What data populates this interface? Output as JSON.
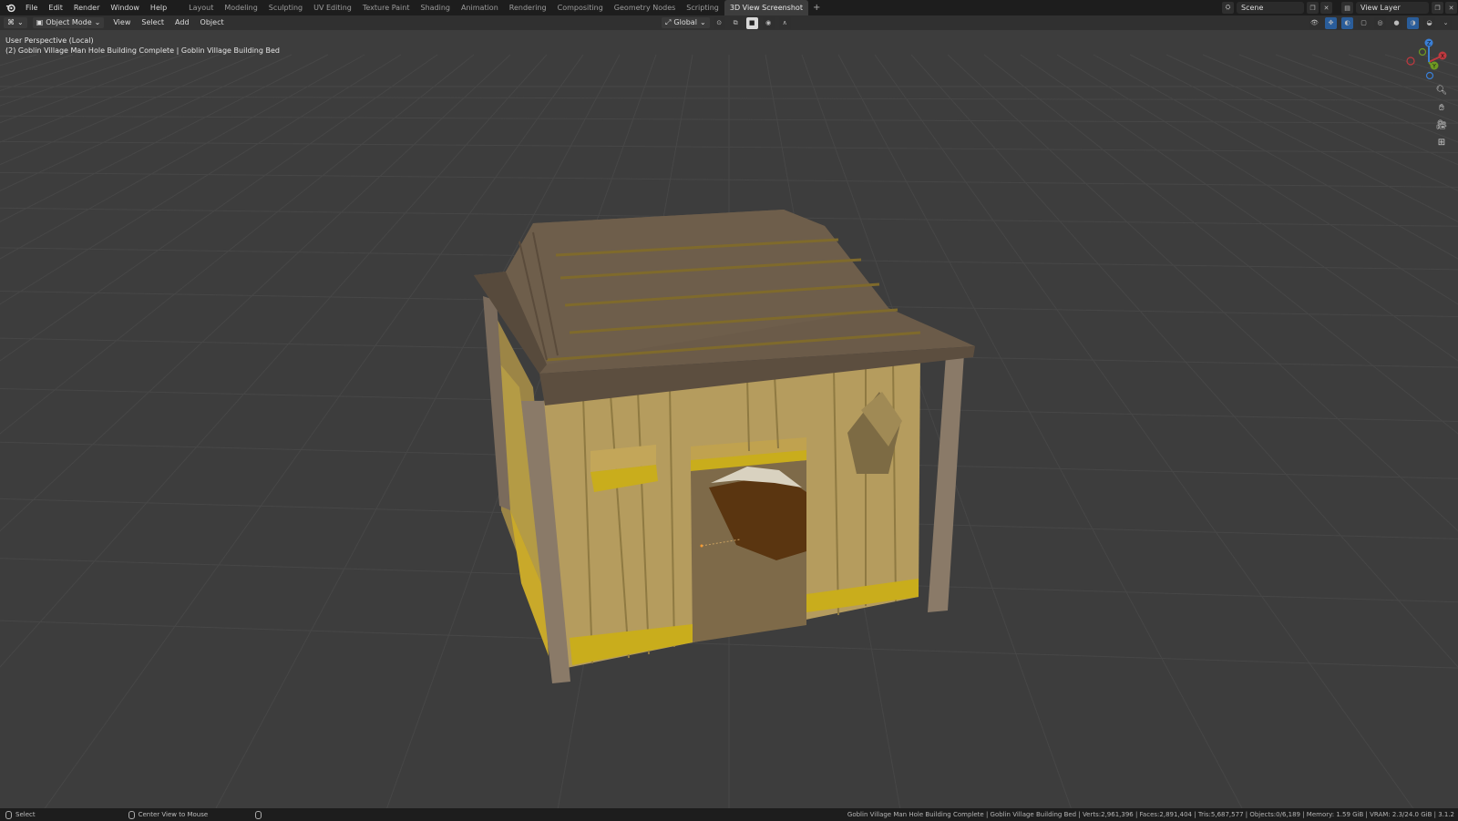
{
  "menu": [
    "File",
    "Edit",
    "Render",
    "Window",
    "Help"
  ],
  "workspaces": [
    "Layout",
    "Modeling",
    "Sculpting",
    "UV Editing",
    "Texture Paint",
    "Shading",
    "Animation",
    "Rendering",
    "Compositing",
    "Geometry Nodes",
    "Scripting",
    "3D View Screenshot"
  ],
  "active_workspace": "3D View Screenshot",
  "add_workspace": "+",
  "scene_name": "Scene",
  "view_layer": "View Layer",
  "header": {
    "mode": "Object Mode",
    "menus": [
      "View",
      "Select",
      "Add",
      "Object"
    ],
    "transform_orientation": "Global"
  },
  "viewport": {
    "perspective_label": "User Perspective (Local)",
    "object_label": "(2) Goblin Village Man Hole Building Complete | Goblin Village Building Bed"
  },
  "gizmo": {
    "x": "X",
    "y": "Y",
    "z": "Z"
  },
  "status": {
    "left_action": "Select",
    "middle_action": "Center View to Mouse",
    "stats": "Goblin Village Man Hole Building Complete | Goblin Village Building Bed | Verts:2,961,396 | Faces:2,891,404 | Tris:5,687,577 | Objects:0/6,189 | Memory: 1.59 GiB | VRAM: 2.3/24.0 GiB | 3.1.2"
  },
  "colors": {
    "topbar": "#1d1d1d",
    "viewport_bg": "#3d3d3d",
    "grid": "#474747",
    "axis_x": "#c0393f",
    "axis_y": "#6f9a22",
    "axis_z": "#3a7fd6",
    "roof": "#6b5b49",
    "walls": "#b59c5e"
  }
}
